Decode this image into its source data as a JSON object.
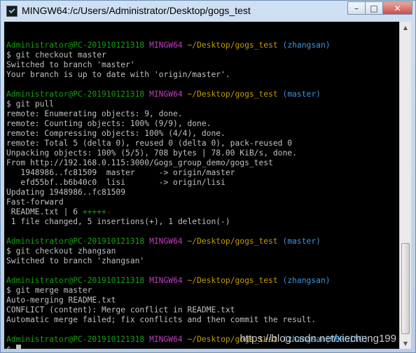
{
  "window": {
    "title": "MINGW64:/c/Users/Administrator/Desktop/gogs_test",
    "minimize_label": "–",
    "maximize_label": "□",
    "close_label": "✕",
    "icon": "terminal-icon"
  },
  "prompt": {
    "user": "Administrator@PC-20191012131 8",
    "user_host": "Administrator@PC-201910121318",
    "system": "MINGW64",
    "path": "~/Desktop/gogs_test",
    "symbol": "$"
  },
  "blocks": [
    {
      "branch": "(zhangsan)",
      "command": "git checkout master",
      "output": [
        "Switched to branch 'master'",
        "Your branch is up to date with 'origin/master'."
      ]
    },
    {
      "branch": "(master)",
      "command": "git pull",
      "output": [
        "remote: Enumerating objects: 9, done.",
        "remote: Counting objects: 100% (9/9), done.",
        "remote: Compressing objects: 100% (4/4), done.",
        "remote: Total 5 (delta 0), reused 0 (delta 0), pack-reused 0",
        "Unpacking objects: 100% (5/5), 708 bytes | 78.00 KiB/s, done.",
        "From http://192.168.0.115:3000/Gogs_group_demo/gogs_test",
        "   1948986..fc81509  master     -> origin/master",
        "   efd55bf..b6b40c0  lisi       -> origin/lisi",
        "Updating 1948986..fc81509",
        "Fast-forward"
      ]
    },
    {
      "branch": "(master)",
      "command": "git checkout zhangsan",
      "output": [
        "Switched to branch 'zhangsan'"
      ]
    },
    {
      "branch": "(zhangsan)",
      "command": "git merge master",
      "output": [
        "Auto-merging README.txt",
        "CONFLICT (content): Merge conflict in README.txt",
        "Automatic merge failed; fix conflicts and then commit the result."
      ]
    },
    {
      "branch": "(zhangsan|MERGING)",
      "command": "",
      "output": []
    }
  ],
  "diffstat": {
    "file": " README.txt | 6 ",
    "plus": "+++++",
    "minus": "-",
    "summary": " 1 file changed, 5 insertions(+), 1 deletion(-)"
  },
  "watermark": "https://blog.csdn.net/xiecheng199",
  "colors": {
    "background": "#000000",
    "text": "#c0c0c0",
    "user": "#13a10e",
    "system": "#bc3fbc",
    "path": "#c19c00",
    "branch": "#3a96dd"
  }
}
